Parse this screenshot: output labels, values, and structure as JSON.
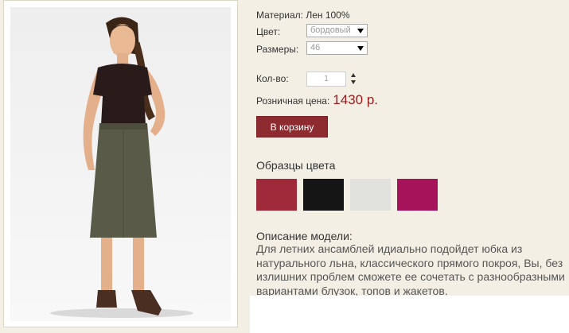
{
  "product": {
    "material_label": "Материал:",
    "material_value": "Лен 100%",
    "color_label": "Цвет:",
    "color_selected": "бордовый",
    "size_label": "Размеры:",
    "size_selected": "46",
    "qty_label": "Кол-во:",
    "qty_value": "1",
    "price_label": "Розничная цена:",
    "price_value": "1430 р.",
    "cart_button": "В корзину"
  },
  "swatches": {
    "title": "Образцы цвета",
    "items": [
      {
        "name": "burgundy",
        "color": "#9e2a3a"
      },
      {
        "name": "black",
        "color": "#151515"
      },
      {
        "name": "light-gray",
        "color": "#e1e1de"
      },
      {
        "name": "magenta",
        "color": "#a5145a"
      }
    ]
  },
  "description": {
    "title": "Описание модели:",
    "text": "Для летних ансамблей идиально подойдет юбка из натурального льна, классического прямого покроя, Вы, без излишних проблем сможете ее сочетать с разнообразными вариантами блузок, топов и жакетов."
  },
  "colors": {
    "accent": "#8e2b30",
    "price": "#9b1c1c",
    "background": "#f3efe4"
  }
}
